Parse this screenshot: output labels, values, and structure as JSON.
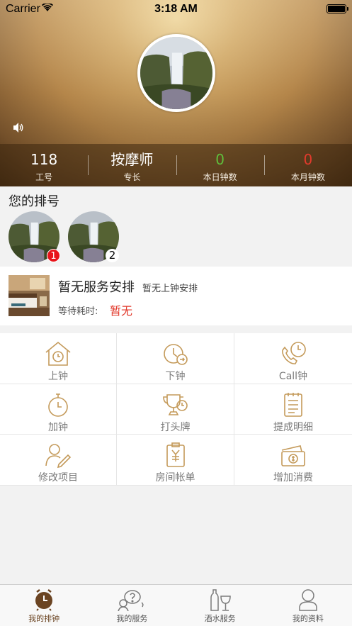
{
  "status_bar": {
    "carrier": "Carrier",
    "time": "3:18 AM"
  },
  "profile": {
    "stats": [
      {
        "value": "118",
        "label": "工号",
        "color": "#ffffff"
      },
      {
        "value": "按摩师",
        "label": "专长",
        "color": "#ffffff"
      },
      {
        "value": "0",
        "label": "本日钟数",
        "color": "#5fbf3c"
      },
      {
        "value": "0",
        "label": "本月钟数",
        "color": "#e23a2c"
      }
    ]
  },
  "queue": {
    "title": "您的排号",
    "items": [
      {
        "badge": "1"
      },
      {
        "badge": "2"
      }
    ]
  },
  "service": {
    "title": "暂无服务安排",
    "subtitle": "暂无上钟安排",
    "wait_label": "等待耗时:",
    "wait_value": "暂无"
  },
  "grid": [
    {
      "label": "上钟",
      "icon": "clock-in-house-icon"
    },
    {
      "label": "下钟",
      "icon": "clock-out-icon"
    },
    {
      "label": "Call钟",
      "icon": "phone-clock-icon"
    },
    {
      "label": "加钟",
      "icon": "stopwatch-icon"
    },
    {
      "label": "打头牌",
      "icon": "trophy-icon"
    },
    {
      "label": "提成明细",
      "icon": "commission-detail-icon"
    },
    {
      "label": "修改项目",
      "icon": "edit-project-icon"
    },
    {
      "label": "房间帐单",
      "icon": "room-bill-icon"
    },
    {
      "label": "增加消费",
      "icon": "add-consumption-icon"
    }
  ],
  "tabbar": [
    {
      "label": "我的排钟",
      "icon": "alarm-clock-icon",
      "active": true
    },
    {
      "label": "我的服务",
      "icon": "service-chat-icon",
      "active": false
    },
    {
      "label": "酒水服务",
      "icon": "drinks-icon",
      "active": false
    },
    {
      "label": "我的资料",
      "icon": "profile-icon",
      "active": false
    }
  ],
  "colors": {
    "accent": "#b8894e",
    "icon_gold": "#c49a5a",
    "active_tab": "#6b4422",
    "red": "#e23a2c",
    "green": "#5fbf3c"
  }
}
